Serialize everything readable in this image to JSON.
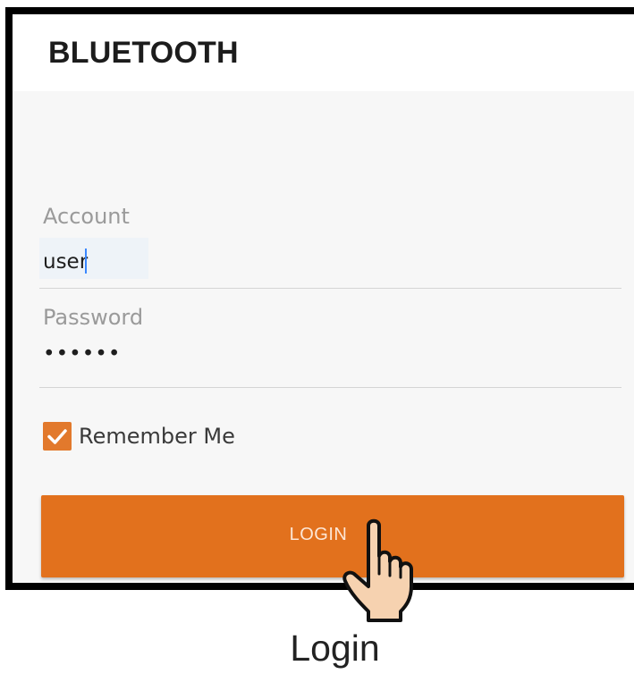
{
  "app": {
    "title": "BLUETOOTH"
  },
  "form": {
    "account_label": "Account",
    "account_value": "user",
    "password_label": "Password",
    "password_value": "••••••",
    "remember_label": "Remember Me",
    "remember_checked": true,
    "login_label": "LOGIN"
  },
  "caption": {
    "text": "Login"
  },
  "icons": {
    "checkbox": "checkmark-icon",
    "pointer": "hand-pointer-icon"
  },
  "colors": {
    "accent": "#e2711d",
    "checkbox": "#e2792c",
    "field_label": "#9a9a9a",
    "divider": "#d5d5d5"
  }
}
